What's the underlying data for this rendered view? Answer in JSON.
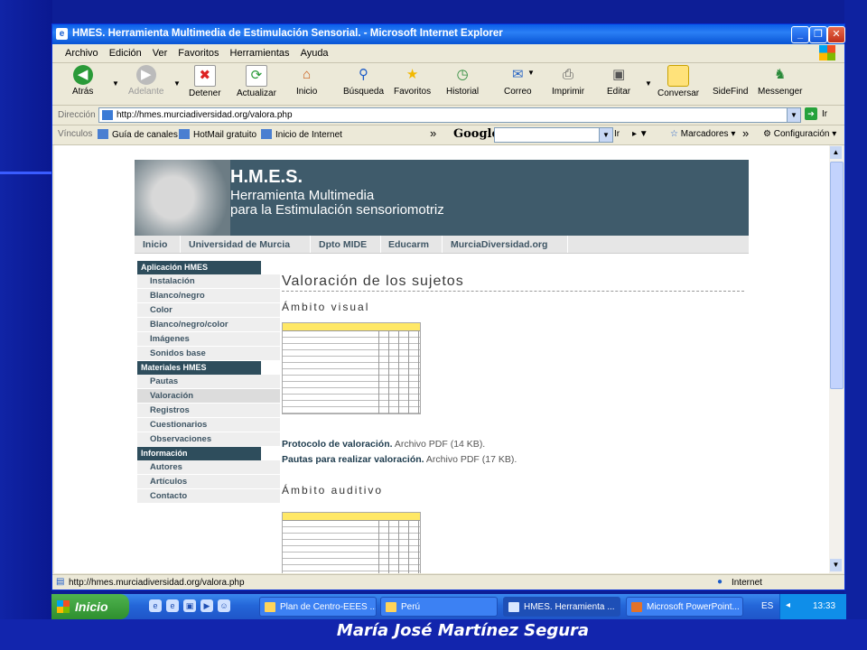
{
  "slide": {
    "author": "María José Martínez Segura"
  },
  "window": {
    "title": "HMES. Herramienta Multimedia de Estimulación Sensorial. - Microsoft Internet Explorer",
    "controls": [
      "_",
      "❐",
      "✕"
    ]
  },
  "menu": [
    "Archivo",
    "Edición",
    "Ver",
    "Favoritos",
    "Herramientas",
    "Ayuda"
  ],
  "toolbar": {
    "atras": "Atrás",
    "adelante": "Adelante",
    "detener": "Detener",
    "actualizar": "Actualizar",
    "inicio": "Inicio",
    "busqueda": "Búsqueda",
    "favoritos": "Favoritos",
    "historial": "Historial",
    "correo": "Correo",
    "imprimir": "Imprimir",
    "editar": "Editar",
    "conversar": "Conversar",
    "sidefind": "SideFind",
    "messenger": "Messenger"
  },
  "address": {
    "label": "Dirección",
    "url": "http://hmes.murciadiversidad.org/valora.php",
    "go": "Ir"
  },
  "links": {
    "label": "Vínculos",
    "items": [
      "Guía de canales",
      "HotMail gratuito",
      "Inicio de Internet"
    ],
    "google": "Google",
    "ir": "Ir",
    "marcadores": "Marcadores",
    "configuracion": "Configuración"
  },
  "site": {
    "title": "H.M.E.S.",
    "subtitle1": "Herramienta Multimedia",
    "subtitle2": "para la Estimulación sensoriomotriz",
    "nav": [
      "Inicio",
      "Universidad de Murcia",
      "Dpto MIDE",
      "Educarm",
      "MurciaDiversidad.org"
    ],
    "sidebar": {
      "sec1": "Aplicación HMES",
      "sec1_items": [
        "Instalación",
        "Blanco/negro",
        "Color",
        "Blanco/negro/color",
        "Imágenes",
        "Sonidos base"
      ],
      "sec2": "Materiales HMES",
      "sec2_items": [
        "Pautas",
        "Valoración",
        "Registros",
        "Cuestionarios",
        "Observaciones"
      ],
      "sec3": "Información",
      "sec3_items": [
        "Autores",
        "Artículos",
        "Contacto"
      ]
    },
    "heading": "Valoración de los sujetos",
    "visual": "Ámbito visual",
    "auditivo": "Ámbito auditivo",
    "doc1_link": "Protocolo de valoración.",
    "doc1_meta": " Archivo PDF (14 KB).",
    "doc2_link": "Pautas para realizar valoración.",
    "doc2_meta": " Archivo PDF (17 KB)."
  },
  "status": {
    "url": "http://hmes.murciadiversidad.org/valora.php",
    "zone": "Internet"
  },
  "taskbar": {
    "start": "Inicio",
    "tasks": [
      "Plan de Centro-EEES ...",
      "Perú",
      "HMES. Herramienta ...",
      "Microsoft PowerPoint..."
    ],
    "lang": "ES",
    "clock": "13:33"
  }
}
